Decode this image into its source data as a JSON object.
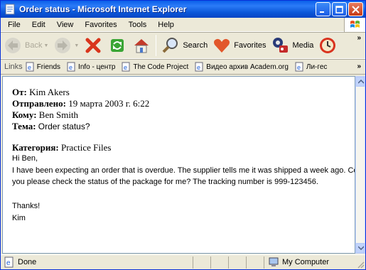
{
  "window": {
    "title": "Order status - Microsoft Internet Explorer"
  },
  "menu": {
    "items": [
      "File",
      "Edit",
      "View",
      "Favorites",
      "Tools",
      "Help"
    ]
  },
  "toolbar": {
    "back_label": "Back",
    "search_label": "Search",
    "favorites_label": "Favorites",
    "media_label": "Media"
  },
  "links": {
    "label": "Links",
    "items": [
      "Friends",
      "Info - центр",
      "The Code Project",
      "Видео архив Academ.org",
      "Ли-гес"
    ]
  },
  "message": {
    "from_label": "От:",
    "from_value": "Kim Akers",
    "sent_label": "Отправлено:",
    "sent_value": "19 марта 2003 г. 6:22",
    "to_label": "Кому:",
    "to_value": "Ben Smith",
    "subject_label": "Тема:",
    "subject_value": "Order status?",
    "category_label": "Категория:",
    "category_value": "Practice Files",
    "greeting": "Hi Ben,",
    "line1": "I have been expecting an order that is overdue.  The supplier tells me it was shipped a week ago.  Could",
    "line2": "you please check the status of the package for me?  The tracking number is 999-123456.",
    "thanks": "Thanks!",
    "signature": "Kim"
  },
  "status": {
    "text": "Done",
    "zone": "My Computer"
  }
}
